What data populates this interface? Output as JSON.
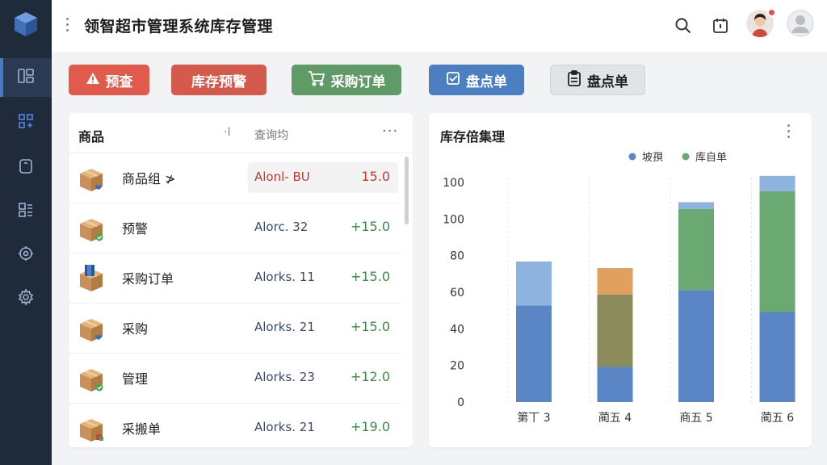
{
  "header": {
    "title": "领智超市管理系统库存管理"
  },
  "actions": {
    "preview": "预查",
    "stock_warning": "库存预警",
    "purchase_order": "采购订单",
    "stocktake_1": "盘点单",
    "stocktake_2": "盘点单"
  },
  "product_panel": {
    "column_product": "商品",
    "column_sep": "·I",
    "search_label": "查询均",
    "rows": [
      {
        "name": "商品组",
        "suffix": "≯",
        "stock": "Alonl- BU",
        "delta": "15.0",
        "highlight": true,
        "thumb": "box-heart"
      },
      {
        "name": "预警",
        "suffix": "",
        "stock": "Alorc. 32",
        "delta": "+15.0",
        "highlight": false,
        "thumb": "box-check"
      },
      {
        "name": "采购订单",
        "suffix": "",
        "stock": "Alorks. 11",
        "delta": "+15.0",
        "highlight": false,
        "thumb": "box-cube"
      },
      {
        "name": "采购",
        "suffix": "",
        "stock": "Alorks. 21",
        "delta": "+15.0",
        "highlight": false,
        "thumb": "box-heart"
      },
      {
        "name": "管理",
        "suffix": "",
        "stock": "Alorks. 23",
        "delta": "+12.0",
        "highlight": false,
        "thumb": "box-check"
      },
      {
        "name": "采搬单",
        "suffix": "",
        "stock": "Alorks. 21",
        "delta": "+19.0",
        "highlight": false,
        "thumb": "box-tag"
      }
    ]
  },
  "chart_panel": {
    "title": "库存倍集理"
  },
  "chart_data": {
    "type": "bar",
    "stacked": true,
    "categories": [
      "第丅 3",
      "蔺五 4",
      "商五 5",
      "蔺五 6"
    ],
    "y_tick_labels": [
      "100",
      "100",
      "80",
      "60",
      "40",
      "20",
      "0"
    ],
    "ylim": [
      0,
      100
    ],
    "legend": [
      {
        "name": "坡孭",
        "color": "#5b86c5"
      },
      {
        "name": "库自单",
        "color": "#6aaa72"
      }
    ],
    "series": [
      {
        "name": "base",
        "color": "#5b86c5",
        "values": [
          44,
          16,
          51,
          41
        ]
      },
      {
        "name": "mid",
        "color": "#8a8a5a",
        "values": [
          0,
          33,
          0,
          0
        ]
      },
      {
        "name": "green",
        "color": "#6aaa72",
        "values": [
          0,
          0,
          37,
          55
        ]
      },
      {
        "name": "orange",
        "color": "#e0a15e",
        "values": [
          0,
          12,
          0,
          0
        ]
      },
      {
        "name": "light",
        "color": "#8fb3df",
        "values": [
          20,
          0,
          3,
          7
        ]
      }
    ],
    "grid": "vertical"
  }
}
